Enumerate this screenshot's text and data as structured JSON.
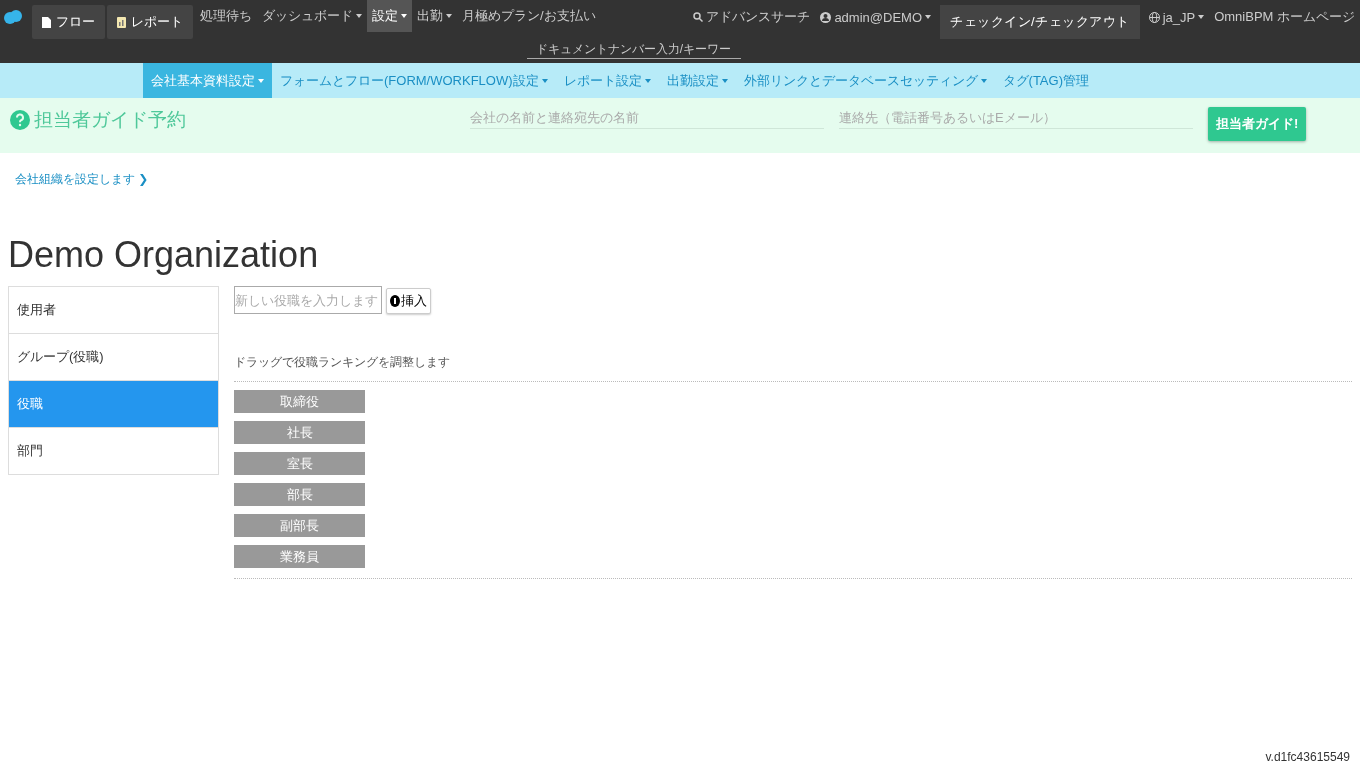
{
  "top_nav": {
    "buttons": [
      {
        "label": "フロー",
        "kind": "document"
      },
      {
        "label": "レポート",
        "kind": "report"
      }
    ],
    "menu": [
      {
        "label": "処理待ち",
        "dropdown": false,
        "selected": false
      },
      {
        "label": "ダッシュボード",
        "dropdown": true,
        "selected": false
      },
      {
        "label": "設定",
        "dropdown": true,
        "selected": true
      },
      {
        "label": "出勤",
        "dropdown": true,
        "selected": false
      },
      {
        "label": "月極めプラン/お支払い",
        "dropdown": false,
        "selected": false
      }
    ],
    "search_link": "アドバンスサーチ",
    "user": "admin@DEMO",
    "checkin_button": "チェックイン/チェックアウト",
    "language": "ja_JP",
    "home_link": "OmniBPM ホームページ",
    "document_search": {
      "placeholder": "ドキュメントナンバー入力/キーワー"
    }
  },
  "sub_nav": [
    {
      "label": "会社基本資料設定",
      "dropdown": true,
      "selected": true
    },
    {
      "label": "フォームとフロー(FORM/WORKFLOW)設定",
      "dropdown": true,
      "selected": false
    },
    {
      "label": "レポート設定",
      "dropdown": true,
      "selected": false
    },
    {
      "label": "出勤設定",
      "dropdown": true,
      "selected": false
    },
    {
      "label": "外部リンクとデータベースセッティング",
      "dropdown": true,
      "selected": false
    },
    {
      "label": "タグ(TAG)管理",
      "dropdown": false,
      "selected": false
    }
  ],
  "guide_bar": {
    "title": "担当者ガイド予約",
    "company_field": {
      "placeholder": "会社の名前と連絡宛先の名前"
    },
    "contact_field": {
      "placeholder": "連絡先（電話番号あるいはEメール）"
    },
    "button": "担当者ガイド!"
  },
  "breadcrumb": "会社組織を設定します ❯",
  "page_title": "Demo Organization",
  "sidebar": {
    "items": [
      {
        "label": "使用者",
        "selected": false
      },
      {
        "label": "グループ(役職)",
        "selected": false
      },
      {
        "label": "役職",
        "selected": true
      },
      {
        "label": "部門",
        "selected": false
      }
    ]
  },
  "content": {
    "new_position_field": {
      "placeholder": "新しい役職を入力します"
    },
    "insert_button": "挿入",
    "hint": "ドラッグで役職ランキングを調整します",
    "positions": [
      "取締役",
      "社長",
      "室長",
      "部長",
      "副部長",
      "業務員"
    ]
  },
  "version": "v.d1fc43615549"
}
